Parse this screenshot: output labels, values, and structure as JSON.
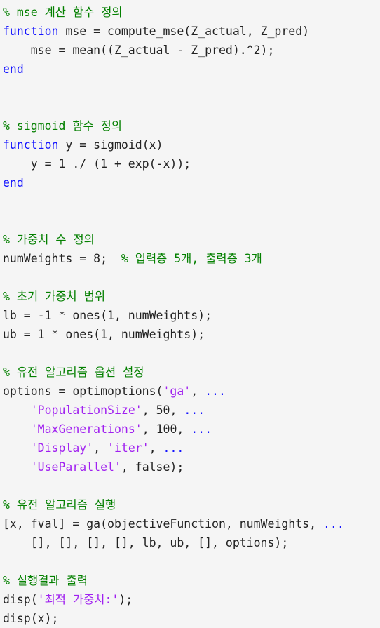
{
  "editor": {
    "language": "MATLAB",
    "background_color": "#f5f5f5",
    "colors": {
      "plain": "#222222",
      "comment": "#048000",
      "keyword": "#1414ff",
      "string": "#a020f0",
      "continuation": "#1414ff"
    }
  },
  "lines": [
    {
      "id": "line-1",
      "tokens": [
        {
          "t": "% mse 계산 함수 정의",
          "c": "comment"
        }
      ]
    },
    {
      "id": "line-2",
      "tokens": [
        {
          "t": "function",
          "c": "keyword"
        },
        {
          "t": " mse = compute_mse(Z_actual, Z_pred)",
          "c": "plain"
        }
      ]
    },
    {
      "id": "line-3",
      "tokens": [
        {
          "t": "    mse = mean((Z_actual - Z_pred).^2);",
          "c": "plain"
        }
      ]
    },
    {
      "id": "line-4",
      "tokens": [
        {
          "t": "end",
          "c": "keyword"
        }
      ]
    },
    {
      "id": "line-5",
      "tokens": []
    },
    {
      "id": "line-6",
      "tokens": []
    },
    {
      "id": "line-7",
      "tokens": [
        {
          "t": "% sigmoid 함수 정의",
          "c": "comment"
        }
      ]
    },
    {
      "id": "line-8",
      "tokens": [
        {
          "t": "function",
          "c": "keyword"
        },
        {
          "t": " y = sigmoid(x)",
          "c": "plain"
        }
      ]
    },
    {
      "id": "line-9",
      "tokens": [
        {
          "t": "    y = 1 ./ (1 + exp(-x));",
          "c": "plain"
        }
      ]
    },
    {
      "id": "line-10",
      "tokens": [
        {
          "t": "end",
          "c": "keyword"
        }
      ]
    },
    {
      "id": "line-11",
      "tokens": []
    },
    {
      "id": "line-12",
      "tokens": []
    },
    {
      "id": "line-13",
      "tokens": [
        {
          "t": "% 가중치 수 정의",
          "c": "comment"
        }
      ]
    },
    {
      "id": "line-14",
      "tokens": [
        {
          "t": "numWeights = 8;  ",
          "c": "plain"
        },
        {
          "t": "% 입력층 5개, 출력층 3개",
          "c": "comment"
        }
      ]
    },
    {
      "id": "line-15",
      "tokens": []
    },
    {
      "id": "line-16",
      "tokens": [
        {
          "t": "% 초기 가중치 범위",
          "c": "comment"
        }
      ]
    },
    {
      "id": "line-17",
      "tokens": [
        {
          "t": "lb = -1 * ones(1, numWeights);",
          "c": "plain"
        }
      ]
    },
    {
      "id": "line-18",
      "tokens": [
        {
          "t": "ub = 1 * ones(1, numWeights);",
          "c": "plain"
        }
      ]
    },
    {
      "id": "line-19",
      "tokens": []
    },
    {
      "id": "line-20",
      "tokens": [
        {
          "t": "% 유전 알고리즘 옵션 설정",
          "c": "comment"
        }
      ]
    },
    {
      "id": "line-21",
      "tokens": [
        {
          "t": "options = optimoptions(",
          "c": "plain"
        },
        {
          "t": "'ga'",
          "c": "string"
        },
        {
          "t": ", ",
          "c": "plain"
        },
        {
          "t": "...",
          "c": "cont"
        }
      ]
    },
    {
      "id": "line-22",
      "tokens": [
        {
          "t": "    ",
          "c": "plain"
        },
        {
          "t": "'PopulationSize'",
          "c": "string"
        },
        {
          "t": ", 50, ",
          "c": "plain"
        },
        {
          "t": "...",
          "c": "cont"
        }
      ]
    },
    {
      "id": "line-23",
      "tokens": [
        {
          "t": "    ",
          "c": "plain"
        },
        {
          "t": "'MaxGenerations'",
          "c": "string"
        },
        {
          "t": ", 100, ",
          "c": "plain"
        },
        {
          "t": "...",
          "c": "cont"
        }
      ]
    },
    {
      "id": "line-24",
      "tokens": [
        {
          "t": "    ",
          "c": "plain"
        },
        {
          "t": "'Display'",
          "c": "string"
        },
        {
          "t": ", ",
          "c": "plain"
        },
        {
          "t": "'iter'",
          "c": "string"
        },
        {
          "t": ", ",
          "c": "plain"
        },
        {
          "t": "...",
          "c": "cont"
        }
      ]
    },
    {
      "id": "line-25",
      "tokens": [
        {
          "t": "    ",
          "c": "plain"
        },
        {
          "t": "'UseParallel'",
          "c": "string"
        },
        {
          "t": ", false);",
          "c": "plain"
        }
      ]
    },
    {
      "id": "line-26",
      "tokens": []
    },
    {
      "id": "line-27",
      "tokens": [
        {
          "t": "% 유전 알고리즘 실행",
          "c": "comment"
        }
      ]
    },
    {
      "id": "line-28",
      "tokens": [
        {
          "t": "[x, fval] = ga(objectiveFunction, numWeights, ",
          "c": "plain"
        },
        {
          "t": "...",
          "c": "cont"
        }
      ]
    },
    {
      "id": "line-29",
      "tokens": [
        {
          "t": "    [], [], [], [], lb, ub, [], options);",
          "c": "plain"
        }
      ]
    },
    {
      "id": "line-30",
      "tokens": []
    },
    {
      "id": "line-31",
      "tokens": [
        {
          "t": "% 실행결과 출력",
          "c": "comment"
        }
      ]
    },
    {
      "id": "line-32",
      "tokens": [
        {
          "t": "disp(",
          "c": "plain"
        },
        {
          "t": "'최적 가중치:'",
          "c": "string"
        },
        {
          "t": ");",
          "c": "plain"
        }
      ]
    },
    {
      "id": "line-33",
      "tokens": [
        {
          "t": "disp(x);",
          "c": "plain"
        }
      ]
    }
  ]
}
